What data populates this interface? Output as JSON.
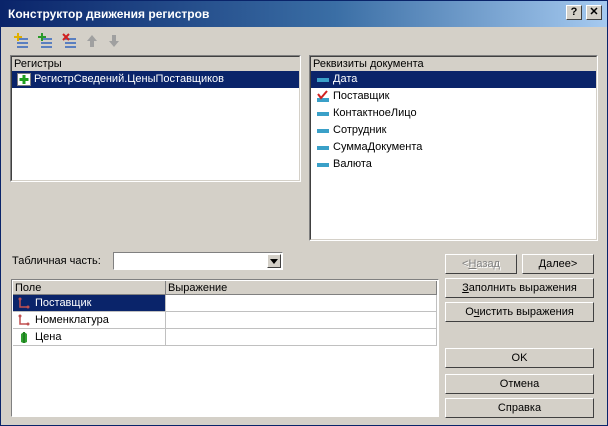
{
  "window": {
    "title": "Конструктор движения регистров",
    "help_glyph": "?",
    "close_glyph": "✕"
  },
  "toolbar": {
    "buttons": [
      {
        "name": "add-register",
        "icon": "add-register-icon"
      },
      {
        "name": "add-all-registers",
        "icon": "add-all-icon"
      },
      {
        "name": "delete-register",
        "icon": "delete-register-icon"
      },
      {
        "name": "move-up",
        "icon": "arrow-up-icon"
      },
      {
        "name": "move-down",
        "icon": "arrow-down-icon"
      }
    ]
  },
  "registers": {
    "header": "Регистры",
    "items": [
      {
        "label": "РегистрСведений.ЦеныПоставщиков",
        "icon": "green-plus-icon",
        "selected": true
      }
    ]
  },
  "attributes": {
    "header": "Реквизиты документа",
    "items": [
      {
        "label": "Дата",
        "icon": "field-icon",
        "selected": true
      },
      {
        "label": "Поставщик",
        "icon": "checked-field-icon",
        "selected": false
      },
      {
        "label": "КонтактноеЛицо",
        "icon": "field-icon",
        "selected": false
      },
      {
        "label": "Сотрудник",
        "icon": "field-icon",
        "selected": false
      },
      {
        "label": "СуммаДокумента",
        "icon": "field-icon",
        "selected": false
      },
      {
        "label": "Валюта",
        "icon": "field-icon",
        "selected": false
      }
    ]
  },
  "tabular": {
    "label": "Табличная часть:",
    "value": ""
  },
  "buttons": {
    "back_pre": "<",
    "back_ul": "Н",
    "back_post": "азад",
    "next": "Далее>",
    "fill_ul": "З",
    "fill_post": "аполнить выражения",
    "clear_pre": "О",
    "clear_ul": "ч",
    "clear_post": "истить выражения",
    "ok": "OK",
    "cancel": "Отмена",
    "help": "Справка"
  },
  "grid": {
    "columns": [
      "Поле",
      "Выражение"
    ],
    "rows": [
      {
        "field": "Поставщик",
        "expression": "",
        "icon": "dimension-icon",
        "selected": true
      },
      {
        "field": "Номенклатура",
        "expression": "",
        "icon": "dimension-icon",
        "selected": false
      },
      {
        "field": "Цена",
        "expression": "",
        "icon": "resource-icon",
        "selected": false
      }
    ]
  },
  "colors": {
    "selection": "#0a246a",
    "face": "#d4d0c8",
    "title_start": "#0a246a",
    "title_end": "#a6caf0"
  }
}
